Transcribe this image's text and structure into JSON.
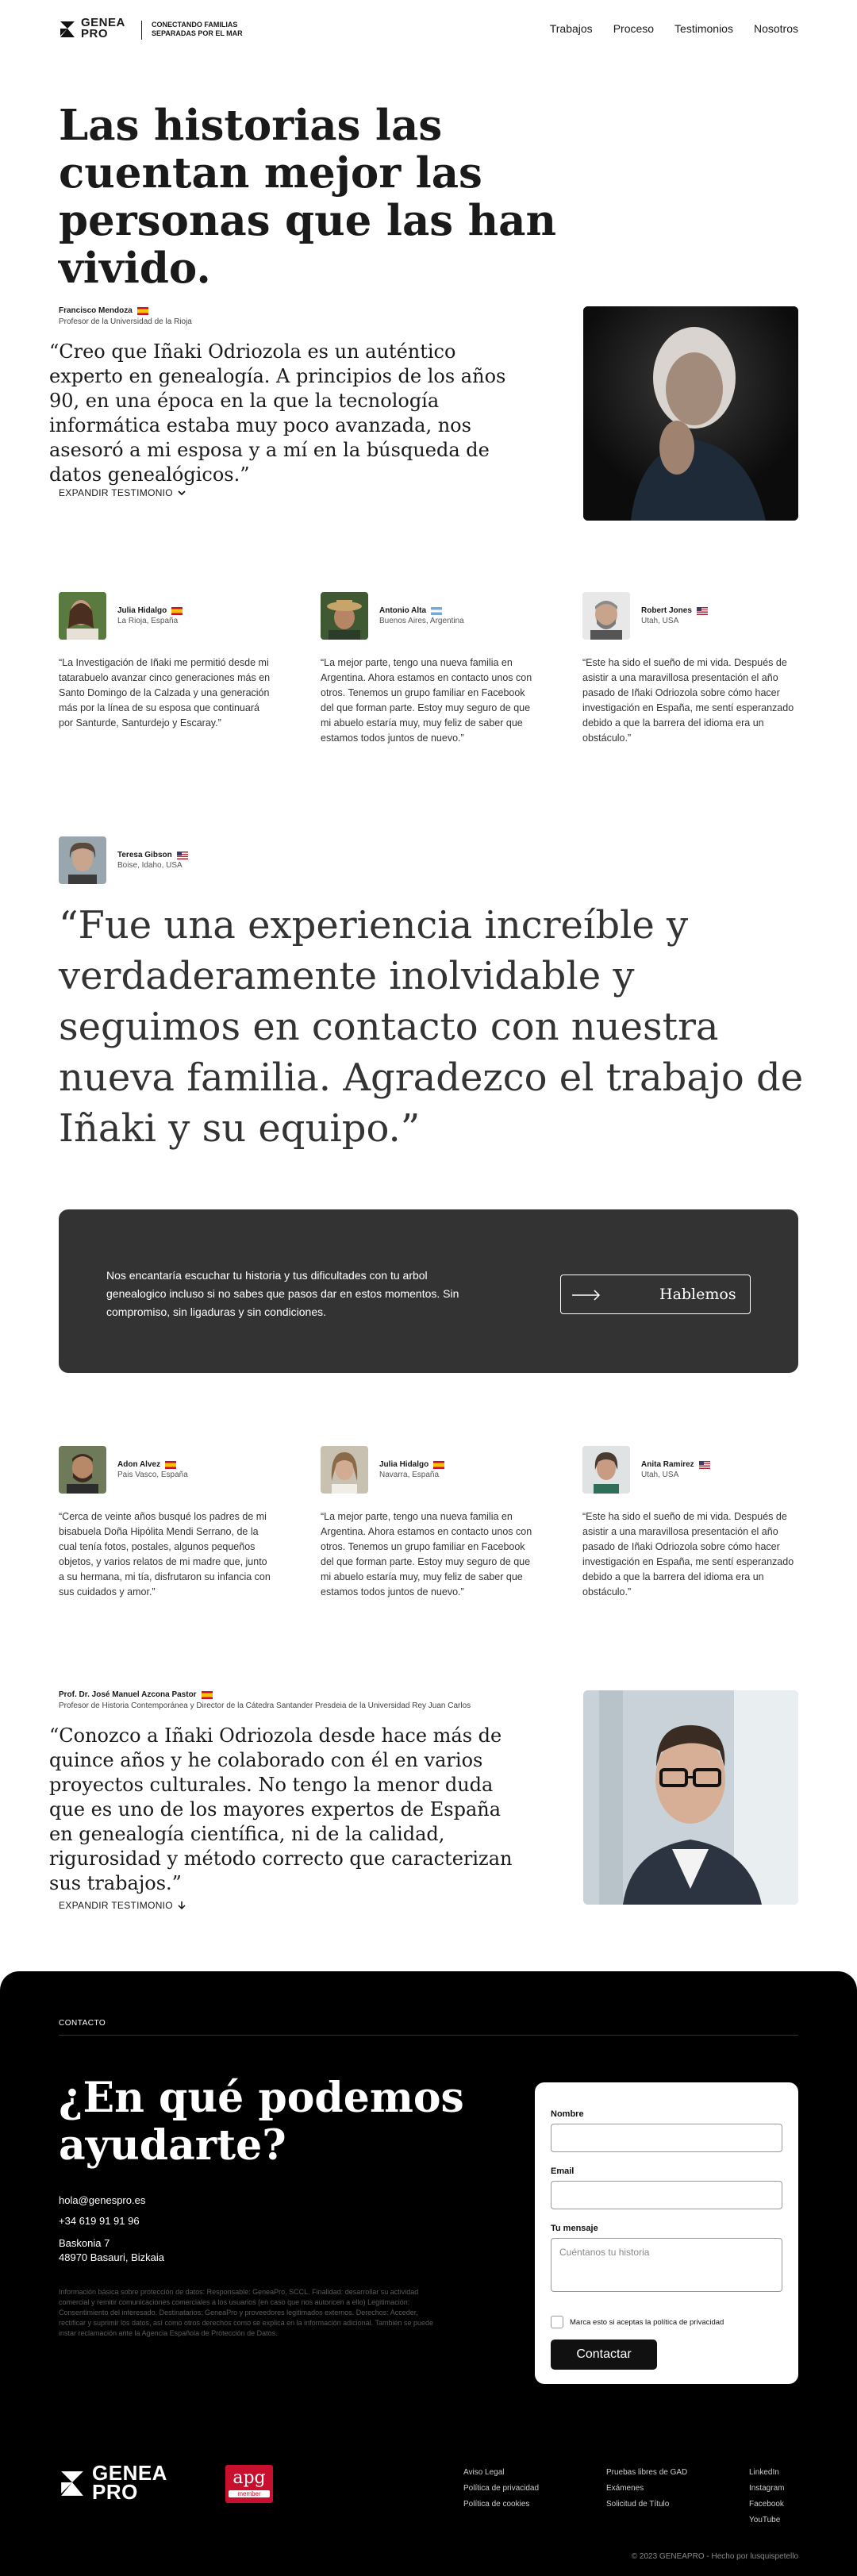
{
  "header": {
    "logo_line1": "GENEA",
    "logo_line2": "PRO",
    "tagline_line1": "CONECTANDO FAMILIAS",
    "tagline_line2": "SEPARADAS POR EL MAR",
    "nav": [
      "Trabajos",
      "Proceso",
      "Testimonios",
      "Nosotros"
    ]
  },
  "hero": {
    "title": "Las historias las cuentan mejor las personas que las han vivido."
  },
  "featured1": {
    "name": "Francisco Mendoza",
    "role": "Profesor de la Universidad de la Rioja",
    "quote": "“Creo que Iñaki Odriozola es un auténtico experto en genealogía. A principios de los años 90, en una época en la que la tecnología informática estaba muy poco avanzada, nos asesoró a mi esposa y a mí en la búsqueda de datos genealógicos.”",
    "expand": "EXPANDIR TESTIMONIO"
  },
  "cards_row1": [
    {
      "name": "Julia Hidalgo",
      "flag": "es",
      "loc": "La Rioja, España",
      "text": "“La Investigación de Iñaki me permitió desde mi tatarabuelo avanzar cinco generaciones más en Santo Domingo de la Calzada y una generación más por la línea de su esposa que continuará por Santurde, Santurdejo y Escaray.”"
    },
    {
      "name": "Antonio Alta",
      "flag": "ar",
      "loc": "Buenos Aires, Argentina",
      "text": "“La mejor parte, tengo una nueva familia en Argentina. Ahora estamos en contacto unos con otros. Tenemos un grupo familiar en Facebook del que forman parte. Estoy muy seguro de que mi abuelo estaría muy, muy feliz de saber que estamos todos juntos de nuevo.”"
    },
    {
      "name": "Robert Jones",
      "flag": "us",
      "loc": "Utah, USA",
      "text": "“Este ha sido el sueño de mi vida. Después de asistir a una maravillosa presentación el año pasado de Iñaki Odriozola sobre cómo hacer investigación en España, me sentí esperanzado debido a que la barrera del idioma era un obstáculo.”"
    }
  ],
  "featured2": {
    "name": "Teresa Gibson",
    "loc": "Boise, Idaho, USA",
    "quote": "“Fue una experiencia increíble y verdaderamente inolvidable y seguimos en contacto con nuestra nueva familia. Agradezco el trabajo de Iñaki y su equipo.”"
  },
  "cta": {
    "text": "Nos encantaría escuchar tu historia y tus dificultades con tu arbol genealogico incluso si no sabes que pasos dar en estos momentos. Sin compromiso, sin ligaduras y sin condiciones.",
    "button": "Hablemos"
  },
  "cards_row2": [
    {
      "name": "Adon Alvez",
      "flag": "es",
      "loc": "Pais Vasco, España",
      "text": "“Cerca de veinte años busqué los padres de mi bisabuela Doña Hipólita Mendi Serrano, de la cual tenía fotos, postales, algunos pequeños objetos, y varios relatos de mi madre que, junto a su hermana, mi tía, disfrutaron su infancia con sus cuidados y amor.”"
    },
    {
      "name": "Julia Hidalgo",
      "flag": "es",
      "loc": "Navarra, España",
      "text": "“La mejor parte, tengo una nueva familia en Argentina. Ahora estamos en contacto unos con otros. Tenemos un grupo familiar en Facebook del que forman parte. Estoy muy seguro de que mi abuelo estaría muy, muy feliz de saber que estamos todos juntos de nuevo.”"
    },
    {
      "name": "Anita Ramirez",
      "flag": "us",
      "loc": "Utah, USA",
      "text": "“Este ha sido el sueño de mi vida. Después de asistir a una maravillosa presentación el año pasado de Iñaki Odriozola sobre cómo hacer investigación en España, me sentí esperanzado debido a que la barrera del idioma era un obstáculo.”"
    }
  ],
  "featured3": {
    "name": "Prof. Dr. José Manuel Azcona Pastor",
    "role": "Profesor de Historia Contemporánea y Director de la Cátedra Santander Presdeia de la Universidad Rey Juan Carlos",
    "quote": "“Conozco a Iñaki Odriozola desde hace más de quince años y he colaborado con él en varios proyectos culturales. No tengo la menor duda que es uno de los mayores expertos de España en genealogía científica, ni de la calidad, rigurosidad y método correcto que caracterizan sus trabajos.”",
    "expand": "EXPANDIR TESTIMONIO"
  },
  "footer": {
    "contact_label": "CONTACTO",
    "title": "¿En qué podemos ayudarte?",
    "email": "hola@genespro.es",
    "phone": "+34 619 91 91 96",
    "address1": "Baskonia 7",
    "address2": "48970 Basauri, Bizkaia",
    "legal": "Información básica sobre protección de datos: Responsable: GeneaPro, SCCL. Finalidad: desarrollar su actividad comercial y remitir comunicaciones comerciales a los usuarios (en caso que nos autoricen a ello) Legitimación: Consentimiento del interesado. Destinatarios: GeneaPro y proveedores legitimados externos. Derechos: Acceder, rectificar y suprimir los datos, así como otros derechos como se explica en la información adicional. También se puede instar reclamación ante la Agencia Española de Protección de Datos.",
    "form": {
      "name_label": "Nombre",
      "email_label": "Email",
      "message_label": "Tu mensaje",
      "message_placeholder": "Cuéntanos tu historia",
      "consent": "Marca esto si aceptas la política de privacidad",
      "submit": "Contactar"
    },
    "apg_text": "apg",
    "apg_sub": "member",
    "links_col1": [
      "Aviso Legal",
      "Política de privacidad",
      "Política de cookies"
    ],
    "links_col2": [
      "Pruebas libres de GAD",
      "Exámenes",
      "Solicitud de Título"
    ],
    "links_col3": [
      "LinkedIn",
      "Instagram",
      "Facebook",
      "YouTube"
    ],
    "copyright": "© 2023 GENEAPRO - Hecho por lusquispetello"
  }
}
